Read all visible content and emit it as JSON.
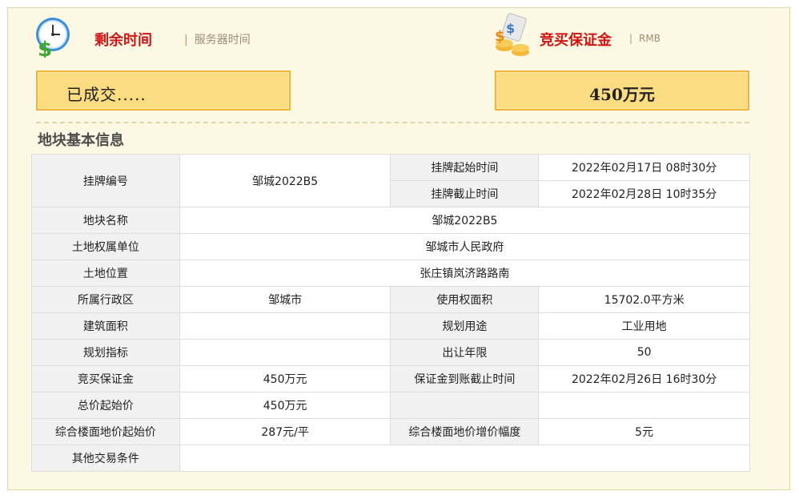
{
  "header": {
    "remaining_time_label": "剩余时间",
    "server_time_label": "服务器时间",
    "deposit_label": "竞买保证金",
    "currency_label": "RMB"
  },
  "status_box": {
    "text": "已成交....."
  },
  "deposit_box": {
    "text": "450万元"
  },
  "section": {
    "title": "地块基本信息"
  },
  "table": {
    "listing_no_label": "挂牌编号",
    "listing_no_value": "邹城2022B5",
    "start_time_label": "挂牌起始时间",
    "start_time_value": "2022年02月17日 08时30分",
    "end_time_label": "挂牌截止时间",
    "end_time_value": "2022年02月28日 10时35分",
    "parcel_name_label": "地块名称",
    "parcel_name_value": "邹城2022B5",
    "owner_label": "土地权属单位",
    "owner_value": "邹城市人民政府",
    "location_label": "土地位置",
    "location_value": "张庄镇岚济路路南",
    "district_label": "所属行政区",
    "district_value": "邹城市",
    "area_label": "使用权面积",
    "area_value": "15702.0平方米",
    "building_area_label": "建筑面积",
    "building_area_value": "",
    "planned_use_label": "规划用途",
    "planned_use_value": "工业用地",
    "planning_index_label": "规划指标",
    "planning_index_value": "",
    "term_label": "出让年限",
    "term_value": "50",
    "deposit_label": "竞买保证金",
    "deposit_value": "450万元",
    "deposit_deadline_label": "保证金到账截止时间",
    "deposit_deadline_value": "2022年02月26日 16时30分",
    "total_start_price_label": "总价起始价",
    "total_start_price_value": "450万元",
    "floor_price_label": "综合楼面地价起始价",
    "floor_price_value": "287元/平",
    "floor_increment_label": "综合楼面地价增价幅度",
    "floor_increment_value": "5元",
    "other_terms_label": "其他交易条件",
    "other_terms_value": ""
  },
  "icons": {
    "clock": "clock-dollar-icon",
    "money": "money-coins-icon"
  },
  "colors": {
    "accent_red": "#d01414",
    "box_fill": "#fbdc80",
    "box_border": "#f0b43b",
    "panel_bg": "#fcf8e3"
  }
}
